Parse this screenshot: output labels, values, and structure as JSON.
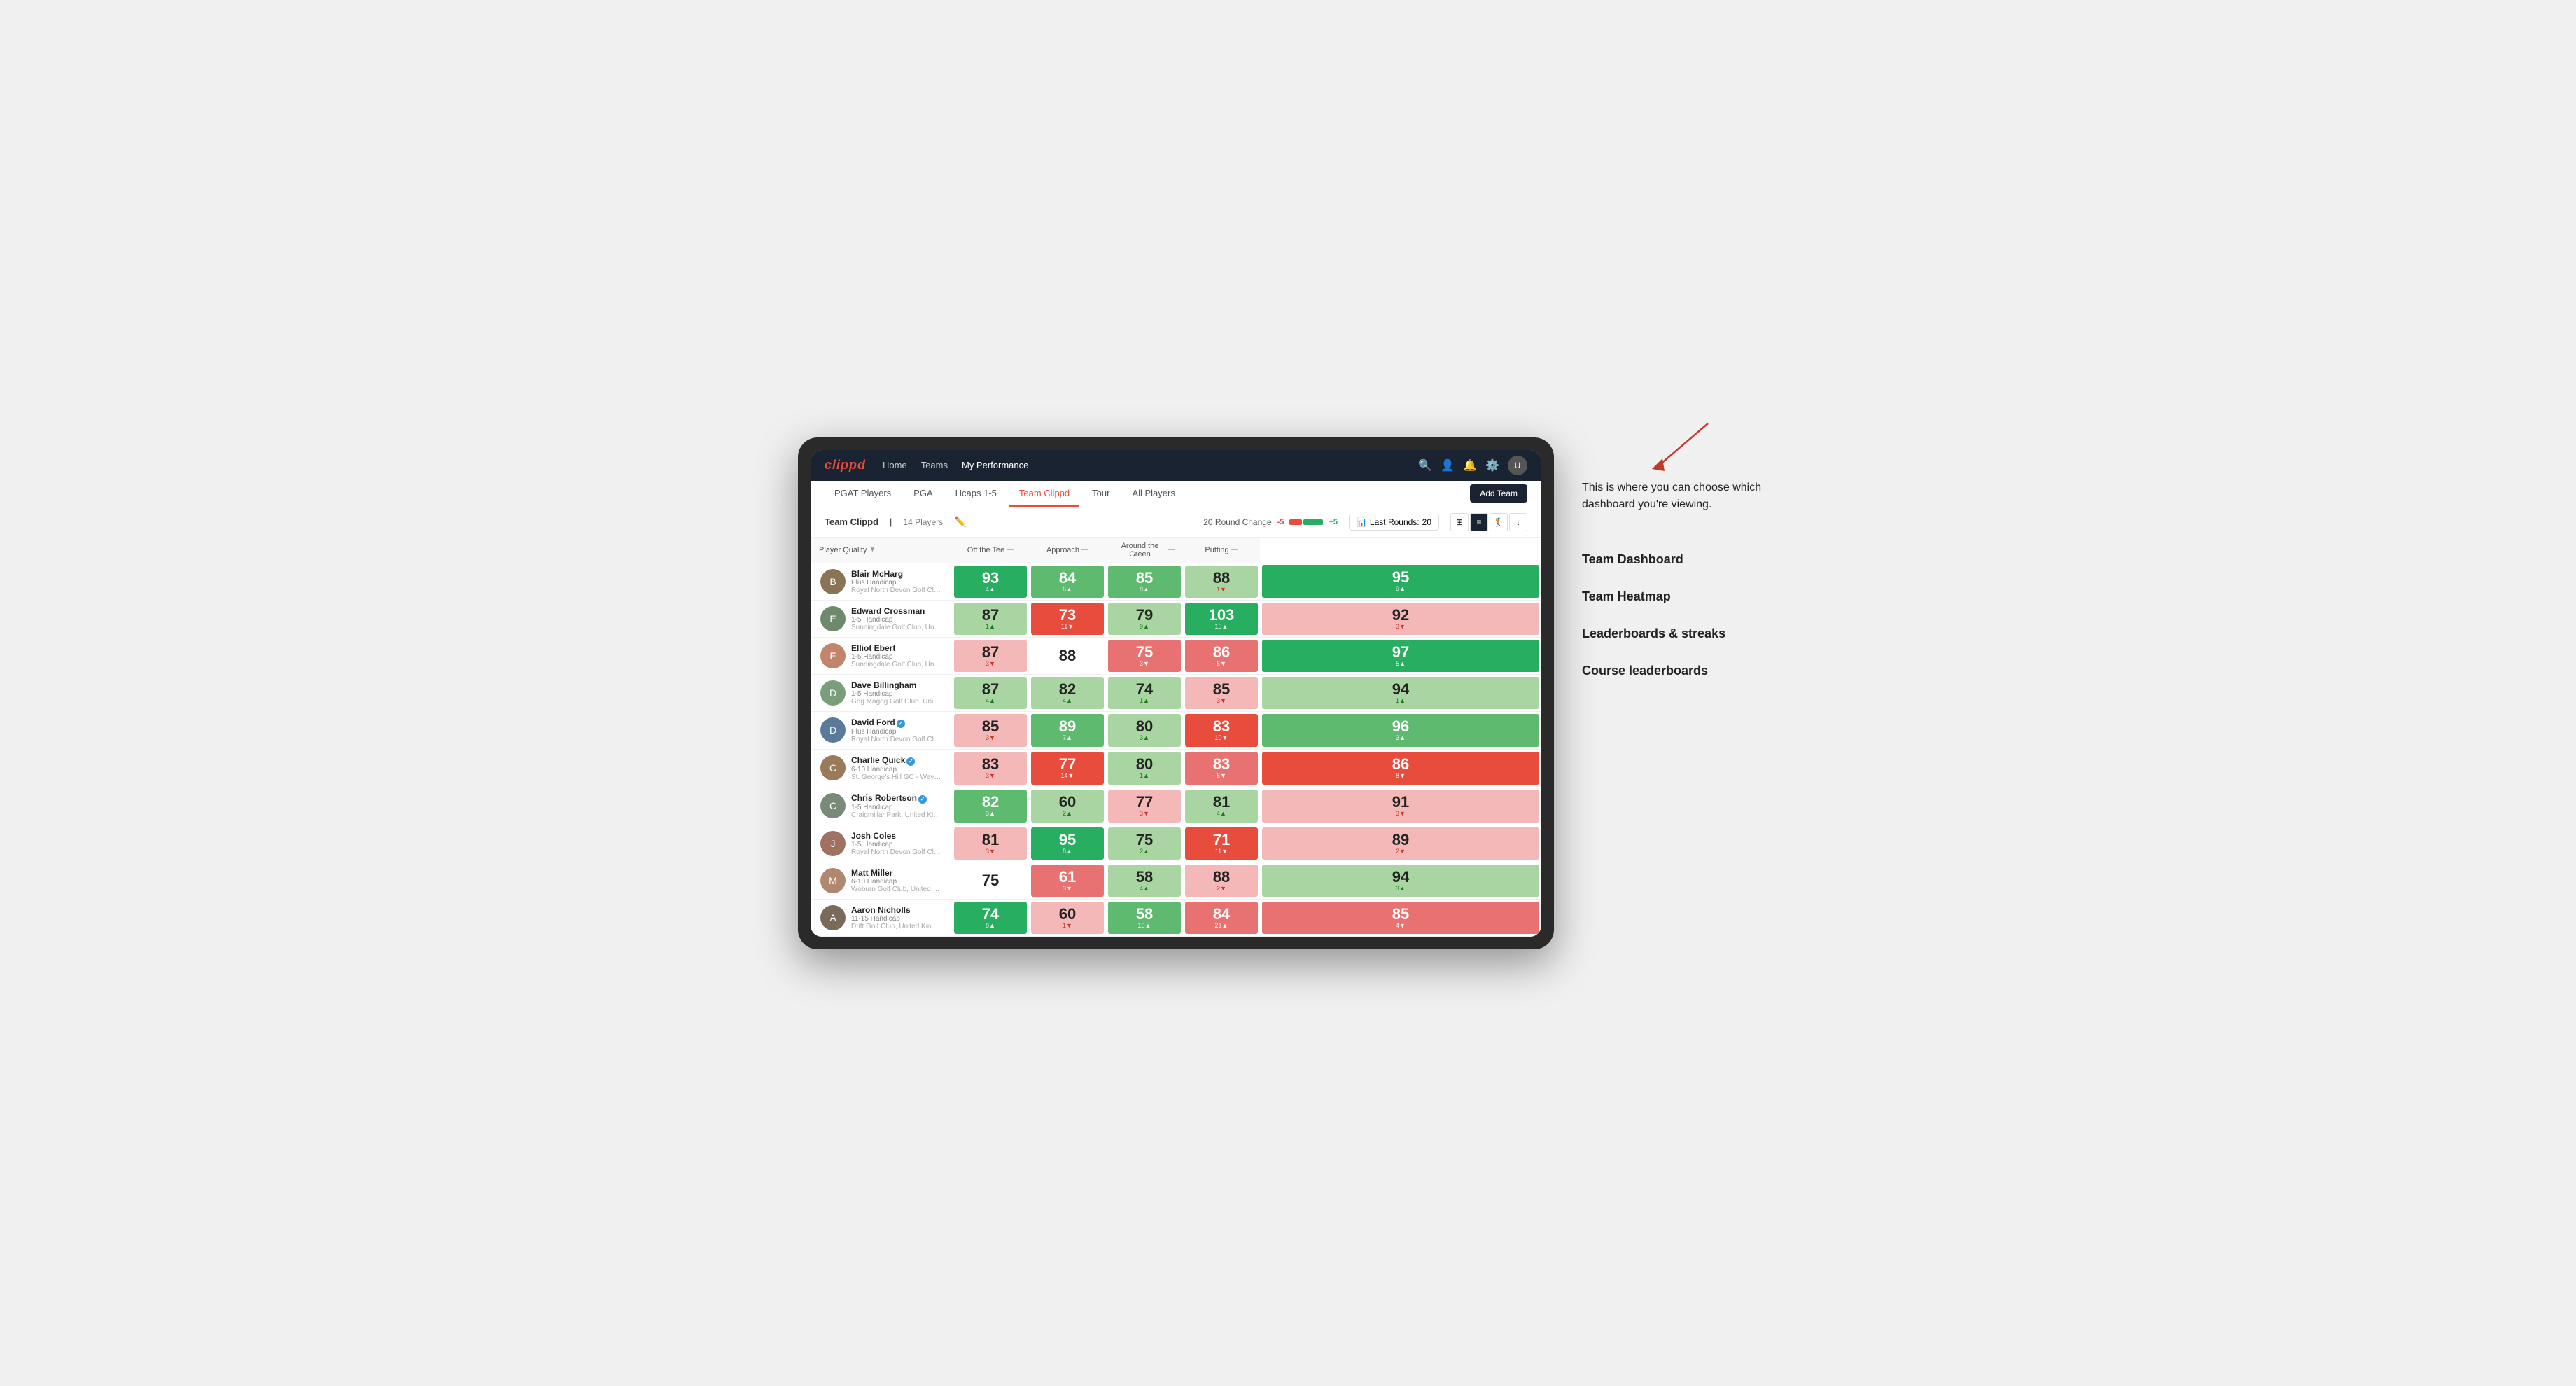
{
  "annotation": {
    "intro": "This is where you can choose which dashboard you're viewing.",
    "items": [
      "Team Dashboard",
      "Team Heatmap",
      "Leaderboards & streaks",
      "Course leaderboards"
    ]
  },
  "nav": {
    "logo": "clippd",
    "links": [
      "Home",
      "Teams",
      "My Performance"
    ],
    "active_link": "My Performance"
  },
  "sub_nav": {
    "items": [
      "PGAT Players",
      "PGA",
      "Hcaps 1-5",
      "Team Clippd",
      "Tour",
      "All Players"
    ],
    "active": "Team Clippd",
    "add_team": "Add Team"
  },
  "team_header": {
    "name": "Team Clippd",
    "separator": "|",
    "count": "14 Players",
    "round_change_label": "20 Round Change",
    "neg": "-5",
    "pos": "+5",
    "last_rounds_label": "Last Rounds:",
    "last_rounds_value": "20"
  },
  "table": {
    "columns": {
      "player": "Player Quality",
      "off_tee": "Off the Tee",
      "approach": "Approach",
      "around_green": "Around the Green",
      "putting": "Putting"
    },
    "players": [
      {
        "name": "Blair McHarg",
        "handicap": "Plus Handicap",
        "club": "Royal North Devon Golf Club, United Kingdom",
        "avatar_color": "#8b7355",
        "scores": {
          "player_quality": {
            "value": "93",
            "change": "4▲",
            "direction": "up",
            "bg": "bg-green-dark"
          },
          "off_tee": {
            "value": "84",
            "change": "6▲",
            "direction": "up",
            "bg": "bg-green-mid"
          },
          "approach": {
            "value": "85",
            "change": "8▲",
            "direction": "up",
            "bg": "bg-green-mid"
          },
          "around_green": {
            "value": "88",
            "change": "1▼",
            "direction": "down",
            "bg": "bg-green-light"
          },
          "putting": {
            "value": "95",
            "change": "9▲",
            "direction": "up",
            "bg": "bg-green-dark"
          }
        }
      },
      {
        "name": "Edward Crossman",
        "handicap": "1-5 Handicap",
        "club": "Sunningdale Golf Club, United Kingdom",
        "avatar_color": "#6d8a6d",
        "scores": {
          "player_quality": {
            "value": "87",
            "change": "1▲",
            "direction": "up",
            "bg": "bg-green-light"
          },
          "off_tee": {
            "value": "73",
            "change": "11▼",
            "direction": "down",
            "bg": "bg-red-dark"
          },
          "approach": {
            "value": "79",
            "change": "9▲",
            "direction": "up",
            "bg": "bg-green-light"
          },
          "around_green": {
            "value": "103",
            "change": "15▲",
            "direction": "up",
            "bg": "bg-green-dark"
          },
          "putting": {
            "value": "92",
            "change": "3▼",
            "direction": "down",
            "bg": "bg-red-light"
          }
        }
      },
      {
        "name": "Elliot Ebert",
        "handicap": "1-5 Handicap",
        "club": "Sunningdale Golf Club, United Kingdom",
        "avatar_color": "#c0856b",
        "scores": {
          "player_quality": {
            "value": "87",
            "change": "3▼",
            "direction": "down",
            "bg": "bg-red-light"
          },
          "off_tee": {
            "value": "88",
            "change": "",
            "direction": "neutral",
            "bg": "bg-white"
          },
          "approach": {
            "value": "75",
            "change": "3▼",
            "direction": "down",
            "bg": "bg-red-mid"
          },
          "around_green": {
            "value": "86",
            "change": "6▼",
            "direction": "down",
            "bg": "bg-red-mid"
          },
          "putting": {
            "value": "97",
            "change": "5▲",
            "direction": "up",
            "bg": "bg-green-dark"
          }
        }
      },
      {
        "name": "Dave Billingham",
        "handicap": "1-5 Handicap",
        "club": "Gog Magog Golf Club, United Kingdom",
        "avatar_color": "#7a9e7a",
        "scores": {
          "player_quality": {
            "value": "87",
            "change": "4▲",
            "direction": "up",
            "bg": "bg-green-light"
          },
          "off_tee": {
            "value": "82",
            "change": "4▲",
            "direction": "up",
            "bg": "bg-green-light"
          },
          "approach": {
            "value": "74",
            "change": "1▲",
            "direction": "up",
            "bg": "bg-green-light"
          },
          "around_green": {
            "value": "85",
            "change": "3▼",
            "direction": "down",
            "bg": "bg-red-light"
          },
          "putting": {
            "value": "94",
            "change": "1▲",
            "direction": "up",
            "bg": "bg-green-light"
          }
        }
      },
      {
        "name": "David Ford",
        "handicap": "Plus Handicap",
        "club": "Royal North Devon Golf Club, United Kingdom",
        "avatar_color": "#5a7a9a",
        "verified": true,
        "scores": {
          "player_quality": {
            "value": "85",
            "change": "3▼",
            "direction": "down",
            "bg": "bg-red-light"
          },
          "off_tee": {
            "value": "89",
            "change": "7▲",
            "direction": "up",
            "bg": "bg-green-mid"
          },
          "approach": {
            "value": "80",
            "change": "3▲",
            "direction": "up",
            "bg": "bg-green-light"
          },
          "around_green": {
            "value": "83",
            "change": "10▼",
            "direction": "down",
            "bg": "bg-red-dark"
          },
          "putting": {
            "value": "96",
            "change": "3▲",
            "direction": "up",
            "bg": "bg-green-mid"
          }
        }
      },
      {
        "name": "Charlie Quick",
        "handicap": "6-10 Handicap",
        "club": "St. George's Hill GC - Weybridge - Surrey, Uni...",
        "avatar_color": "#9a7a5a",
        "verified": true,
        "scores": {
          "player_quality": {
            "value": "83",
            "change": "3▼",
            "direction": "down",
            "bg": "bg-red-light"
          },
          "off_tee": {
            "value": "77",
            "change": "14▼",
            "direction": "down",
            "bg": "bg-red-dark"
          },
          "approach": {
            "value": "80",
            "change": "1▲",
            "direction": "up",
            "bg": "bg-green-light"
          },
          "around_green": {
            "value": "83",
            "change": "6▼",
            "direction": "down",
            "bg": "bg-red-mid"
          },
          "putting": {
            "value": "86",
            "change": "8▼",
            "direction": "down",
            "bg": "bg-red-dark"
          }
        }
      },
      {
        "name": "Chris Robertson",
        "handicap": "1-5 Handicap",
        "club": "Craigmillar Park, United Kingdom",
        "avatar_color": "#7a8a7a",
        "verified": true,
        "scores": {
          "player_quality": {
            "value": "82",
            "change": "3▲",
            "direction": "up",
            "bg": "bg-green-mid"
          },
          "off_tee": {
            "value": "60",
            "change": "2▲",
            "direction": "up",
            "bg": "bg-green-light"
          },
          "approach": {
            "value": "77",
            "change": "3▼",
            "direction": "down",
            "bg": "bg-red-light"
          },
          "around_green": {
            "value": "81",
            "change": "4▲",
            "direction": "up",
            "bg": "bg-green-light"
          },
          "putting": {
            "value": "91",
            "change": "3▼",
            "direction": "down",
            "bg": "bg-red-light"
          }
        }
      },
      {
        "name": "Josh Coles",
        "handicap": "1-5 Handicap",
        "club": "Royal North Devon Golf Club, United Kingdom",
        "avatar_color": "#a07060",
        "scores": {
          "player_quality": {
            "value": "81",
            "change": "3▼",
            "direction": "down",
            "bg": "bg-red-light"
          },
          "off_tee": {
            "value": "95",
            "change": "8▲",
            "direction": "up",
            "bg": "bg-green-dark"
          },
          "approach": {
            "value": "75",
            "change": "2▲",
            "direction": "up",
            "bg": "bg-green-light"
          },
          "around_green": {
            "value": "71",
            "change": "11▼",
            "direction": "down",
            "bg": "bg-red-dark"
          },
          "putting": {
            "value": "89",
            "change": "2▼",
            "direction": "down",
            "bg": "bg-red-light"
          }
        }
      },
      {
        "name": "Matt Miller",
        "handicap": "6-10 Handicap",
        "club": "Woburn Golf Club, United Kingdom",
        "avatar_color": "#b08870",
        "scores": {
          "player_quality": {
            "value": "75",
            "change": "",
            "direction": "neutral",
            "bg": "bg-white"
          },
          "off_tee": {
            "value": "61",
            "change": "3▼",
            "direction": "down",
            "bg": "bg-red-mid"
          },
          "approach": {
            "value": "58",
            "change": "4▲",
            "direction": "up",
            "bg": "bg-green-light"
          },
          "around_green": {
            "value": "88",
            "change": "2▼",
            "direction": "down",
            "bg": "bg-red-light"
          },
          "putting": {
            "value": "94",
            "change": "3▲",
            "direction": "up",
            "bg": "bg-green-light"
          }
        }
      },
      {
        "name": "Aaron Nicholls",
        "handicap": "11-15 Handicap",
        "club": "Drift Golf Club, United Kingdom",
        "avatar_color": "#7a6a5a",
        "scores": {
          "player_quality": {
            "value": "74",
            "change": "8▲",
            "direction": "up",
            "bg": "bg-green-dark"
          },
          "off_tee": {
            "value": "60",
            "change": "1▼",
            "direction": "down",
            "bg": "bg-red-light"
          },
          "approach": {
            "value": "58",
            "change": "10▲",
            "direction": "up",
            "bg": "bg-green-mid"
          },
          "around_green": {
            "value": "84",
            "change": "21▲",
            "direction": "up",
            "bg": "bg-red-mid"
          },
          "putting": {
            "value": "85",
            "change": "4▼",
            "direction": "down",
            "bg": "bg-red-mid"
          }
        }
      }
    ]
  }
}
